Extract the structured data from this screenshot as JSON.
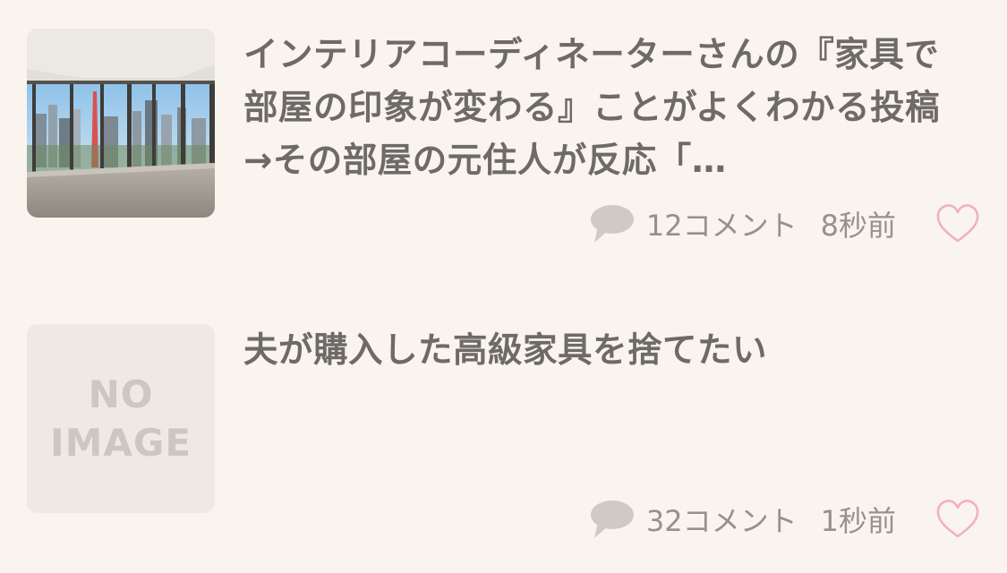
{
  "articles": [
    {
      "title": "インテリアコーディネーターさんの『家具で部屋の印象が変わる』ことがよくわかる投稿→その部屋の元住人が反応「…",
      "thumbnail": "room-photo",
      "comment_count": "12",
      "comment_suffix": "コメント",
      "time": "8秒前"
    },
    {
      "title": "夫が購入した高級家具を捨てたい",
      "thumbnail": "no-image",
      "no_image_line1": "NO",
      "no_image_line2": "IMAGE",
      "comment_count": "32",
      "comment_suffix": "コメント",
      "time": "1秒前"
    }
  ],
  "icons": {
    "comment": "comment-bubble-icon",
    "favorite": "heart-outline-icon"
  },
  "colors": {
    "background": "#faf4ef",
    "title": "#6e6a67",
    "meta": "#97918d",
    "heart": "#f0b1be"
  }
}
